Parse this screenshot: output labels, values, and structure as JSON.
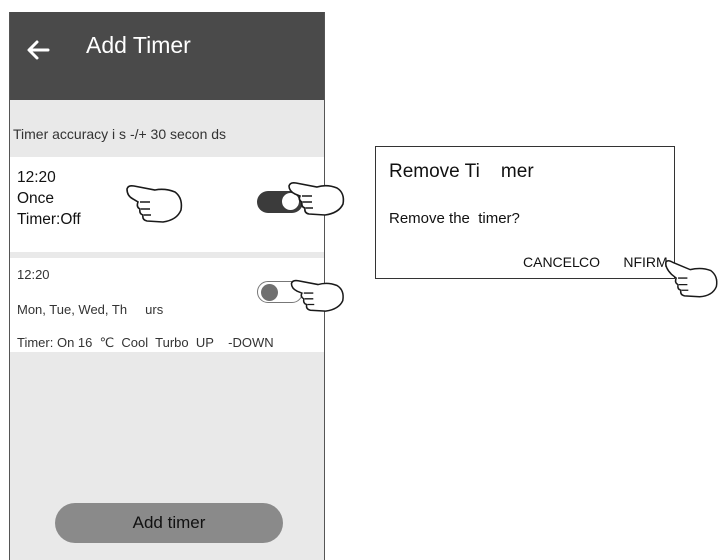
{
  "appbar": {
    "title": "Add Timer",
    "back_icon": "arrow-left-icon"
  },
  "notice": "Timer accuracy i  s -/+ 30 secon  ds",
  "timer1": {
    "time": "12:20",
    "repeat": "Once",
    "status": "Timer:Off",
    "enabled": true
  },
  "timer2": {
    "time": "12:20",
    "days": "Mon, Tue, Wed, Th     urs",
    "detail": "Timer: On 16  ℃  Cool  Turbo  UP    -DOWN",
    "enabled": false
  },
  "add_button": "Add timer",
  "dialog": {
    "title": "Remove Ti    mer",
    "message": "Remove the  timer?",
    "cancel": "CANCEL",
    "confirm": "CO      NFIRM"
  },
  "colors": {
    "appbar": "#4a4a4a",
    "background": "#e9e9e9",
    "toggle_on": "#3b3b3b",
    "button": "#8a8a8a"
  }
}
